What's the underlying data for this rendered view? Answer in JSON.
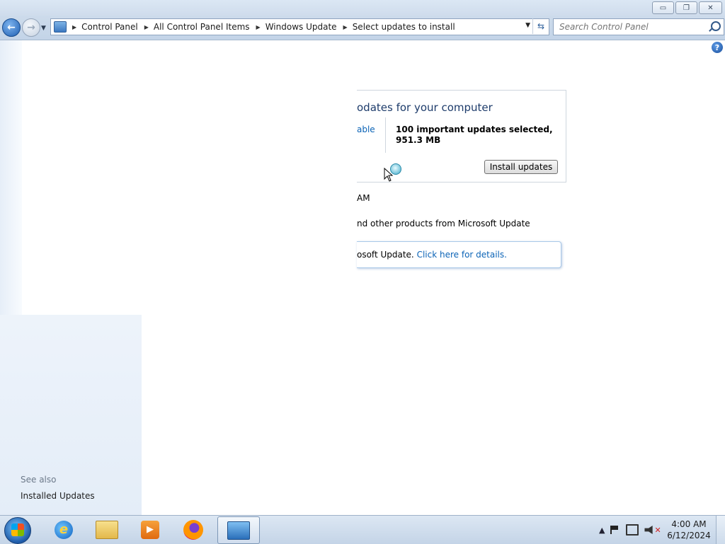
{
  "window": {
    "caption_buttons": {
      "minimize": "▭",
      "maximize": "❐",
      "close": "✕"
    }
  },
  "address_bar": {
    "back_icon": "←",
    "forward_icon": "→",
    "breadcrumbs": [
      "Control Panel",
      "All Control Panel Items",
      "Windows Update",
      "Select updates to install"
    ],
    "refresh_icon": "⇆"
  },
  "search": {
    "placeholder": "Search Control Panel"
  },
  "help": {
    "icon": "?"
  },
  "sidebar": {
    "see_also_label": "See also",
    "installed_updates_link": "Installed Updates"
  },
  "updates_panel": {
    "title": "odates for your computer",
    "available_link": "able",
    "summary": "100 important updates selected, 951.3 MB",
    "install_button": "Install updates"
  },
  "status": {
    "time_fragment": "AM",
    "source_text": "nd other products from Microsoft Update"
  },
  "info_box": {
    "text": "osoft Update.",
    "link": "Click here for details."
  },
  "taskbar": {
    "apps": [
      "Internet Explorer",
      "Windows Explorer",
      "Windows Media Player",
      "Firefox",
      "Control Panel"
    ],
    "active_app": "Control Panel",
    "clock_time": "4:00 AM",
    "clock_date": "6/12/2024",
    "tray_show_hidden": "▲"
  },
  "colors": {
    "link": "#0b63b6",
    "panel_title": "#1e3c6b",
    "sidebar_gradient_bottom": "#e4edf8"
  }
}
